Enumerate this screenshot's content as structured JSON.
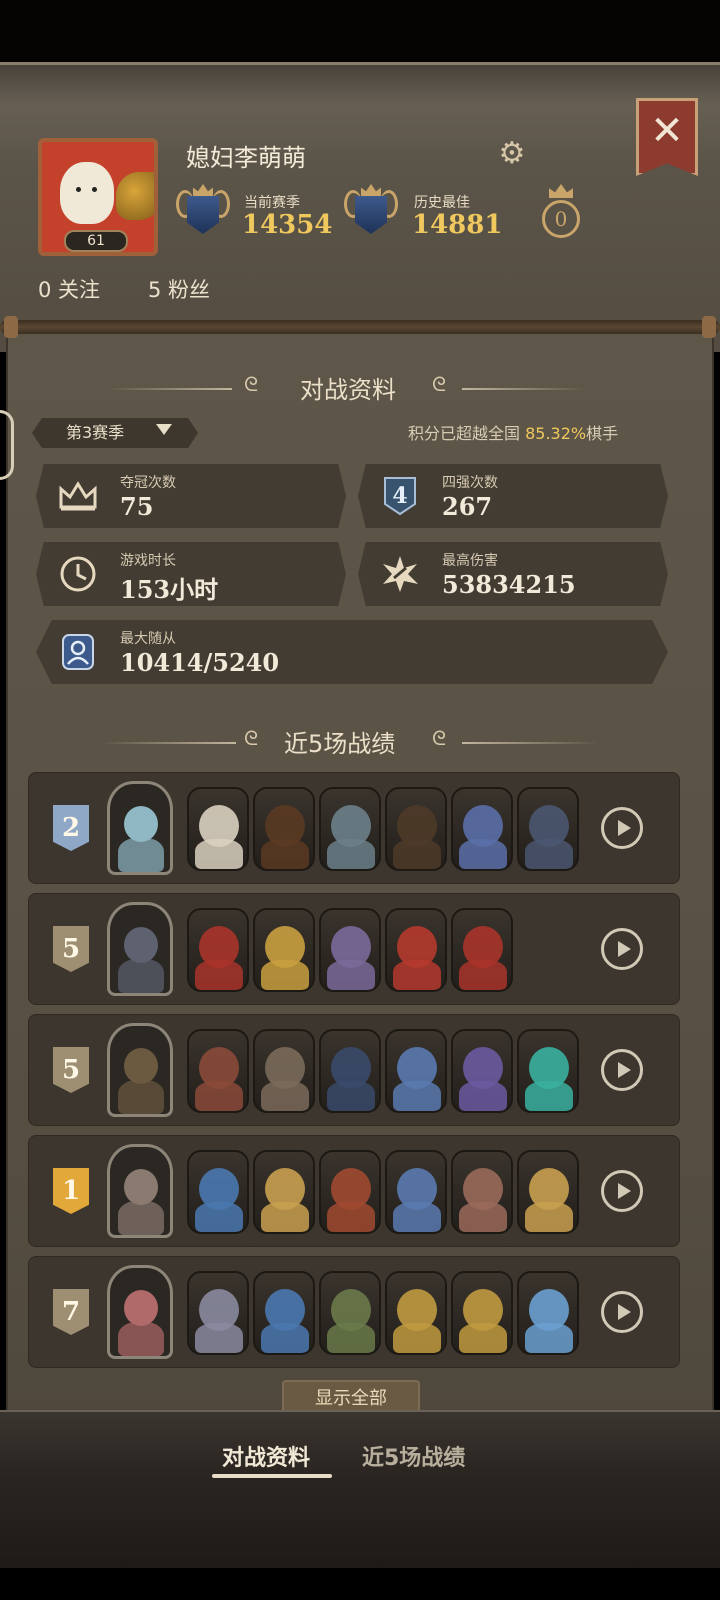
{
  "profile": {
    "name": "媳妇李萌萌",
    "level": "61",
    "current_season_label": "当前赛季",
    "current_season_score": "14354",
    "best_label": "历史最佳",
    "best_score": "14881",
    "crown_count": "0",
    "following": "0 关注",
    "followers": "5 粉丝"
  },
  "battle_stats": {
    "section_title": "对战资料",
    "season_select": "第3赛季",
    "percentile_prefix": "积分已超越全国",
    "percentile_value": "85.32%",
    "percentile_suffix": "棋手",
    "cards": [
      {
        "label": "夺冠次数",
        "value": "75",
        "icon": "crown-icon"
      },
      {
        "label": "四强次数",
        "value": "267",
        "icon": "top4-icon"
      },
      {
        "label": "游戏时长",
        "value": "153小时",
        "icon": "clock-icon"
      },
      {
        "label": "最高伤害",
        "value": "53834215",
        "icon": "damage-icon"
      },
      {
        "label": "最大随从",
        "value": "10414/5240",
        "icon": "minion-icon"
      }
    ]
  },
  "recent": {
    "section_title": "近5场战绩",
    "matches": [
      {
        "place": "2",
        "badge_color": "#8fa8c8",
        "hero_color": "#8fb7c4",
        "minions": [
          "#d9d0c0",
          "#5a3a22",
          "#6b7f8a",
          "#4e3a28",
          "#5a6ea8",
          "#4a5670"
        ]
      },
      {
        "place": "5",
        "badge_color": "#9e8f73",
        "hero_color": "#5d6170",
        "minions": [
          "#a8342a",
          "#c9a040",
          "#7a6a9a",
          "#b53a2e",
          "#a8342a"
        ]
      },
      {
        "place": "5",
        "badge_color": "#9e8f73",
        "hero_color": "#6c5a40",
        "minions": [
          "#8a4a3a",
          "#7a6a5a",
          "#3a4a6a",
          "#5a7ab0",
          "#6a5aa0",
          "#3ab0a0"
        ]
      },
      {
        "place": "1",
        "badge_color": "#e2a93a",
        "hero_color": "#8a7a70",
        "minions": [
          "#4a78b0",
          "#c9a050",
          "#a04a30",
          "#5a7ab0",
          "#9a6a5a",
          "#c9a050"
        ]
      },
      {
        "place": "7",
        "badge_color": "#9e8f73",
        "hero_color": "#b06a6a",
        "minions": [
          "#8a8aa0",
          "#4a78b0",
          "#6a7a4a",
          "#c09a40",
          "#c09a40",
          "#6aa0d0"
        ]
      }
    ],
    "show_all": "显示全部"
  },
  "tabs": {
    "battle_stats": "对战资料",
    "recent5": "近5场战绩"
  },
  "colors": {
    "gold": "#f0c95e",
    "close_banner": "#8d3b2f"
  }
}
